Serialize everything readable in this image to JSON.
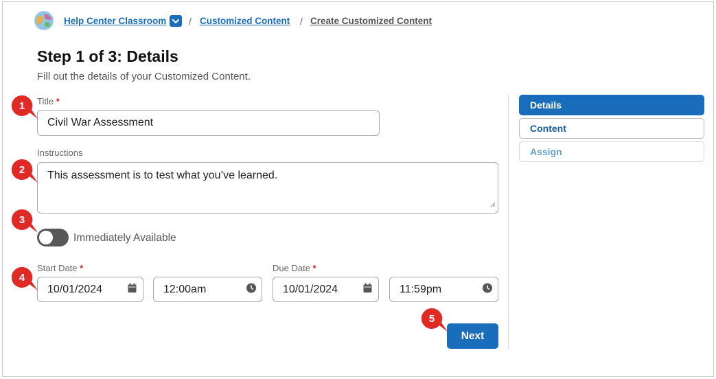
{
  "breadcrumb": {
    "classroom": "Help Center Classroom",
    "separator1": "/",
    "customized": "Customized Content",
    "separator2": "/",
    "current": "Create Customized Content"
  },
  "page": {
    "title": "Step 1 of 3: Details",
    "subtitle": "Fill out the details of your Customized Content."
  },
  "form": {
    "title_label": "Title",
    "title_value": "Civil War Assessment",
    "instructions_label": "Instructions",
    "instructions_value": "This assessment is to test what you’ve learned.",
    "toggle_label": "Immediately Available",
    "toggle_on": false,
    "start_date_label": "Start Date",
    "start_date_value": "10/01/2024",
    "start_time_value": "12:00am",
    "due_date_label": "Due Date",
    "due_date_value": "10/01/2024",
    "due_time_value": "11:59pm",
    "required_mark": "*",
    "next_label": "Next"
  },
  "steps": [
    {
      "label": "Details",
      "state": "active"
    },
    {
      "label": "Content",
      "state": "normal"
    },
    {
      "label": "Assign",
      "state": "disabled"
    }
  ],
  "callouts": [
    "1",
    "2",
    "3",
    "4",
    "5"
  ],
  "colors": {
    "primary": "#1a6dbb",
    "callout": "#e02a26",
    "required": "#d0281f",
    "toggle_off": "#585858"
  },
  "icons": {
    "avatar": "globe-avatar-icon",
    "dropdown": "chevron-down-icon",
    "calendar": "calendar-icon",
    "clock": "clock-icon",
    "resize": "resize-handle-icon"
  }
}
